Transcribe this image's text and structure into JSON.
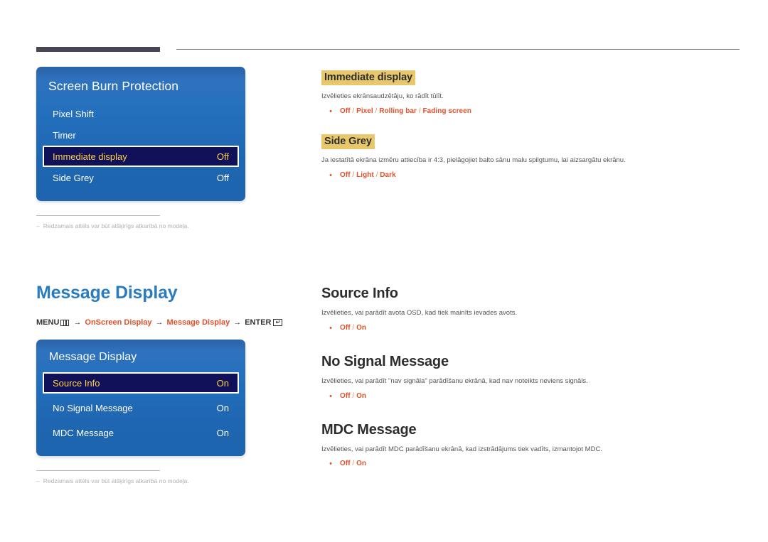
{
  "colors": {
    "accent_orange": "#e0502a",
    "heading_blue": "#2a7cc0",
    "highlight_yellow": "#e8c86a",
    "osd_blue": "#1f66b2",
    "osd_selected_bg": "#111159",
    "osd_selected_text": "#ffd24a"
  },
  "sections": [
    {
      "id": "screen-burn-protection",
      "panel": {
        "title": "Screen Burn Protection",
        "rows": [
          {
            "label": "Pixel Shift",
            "value": "",
            "selected": false
          },
          {
            "label": "Timer",
            "value": "",
            "selected": false
          },
          {
            "label": "Immediate display",
            "value": "Off",
            "selected": true
          },
          {
            "label": "Side Grey",
            "value": "Off",
            "selected": false
          }
        ]
      },
      "footnote": {
        "dash": "–",
        "text": "Redzamais attēls var būt atšķirīgs atkarībā no modeļa."
      },
      "topics": [
        {
          "heading": "Immediate display",
          "heading_style": "highlight",
          "description": "Izvēlieties ekrānsaudzētāju, ko rādīt tūlīt.",
          "bullet": "•",
          "options": [
            "Off",
            "Pixel",
            "Rolling bar",
            "Fading screen"
          ]
        },
        {
          "heading": "Side Grey",
          "heading_style": "highlight",
          "description": "Ja iestatītā ekrāna izmēru attiecība ir 4:3, pielāgojiet balto sānu malu spilgtumu, lai aizsargātu ekrānu.",
          "bullet": "•",
          "options": [
            "Off",
            "Light",
            "Dark"
          ]
        }
      ]
    },
    {
      "id": "message-display",
      "section_title": "Message Display",
      "breadcrumb": {
        "menu_label": "MENU",
        "menu_icon": "menu-icon",
        "arrow": "→",
        "items": [
          "OnScreen Display",
          "Message Display"
        ],
        "enter_label": "ENTER",
        "enter_icon": "enter-key-icon",
        "enter_glyph": "↵"
      },
      "panel": {
        "title": "Message Display",
        "rows": [
          {
            "label": "Source Info",
            "value": "On",
            "selected": true
          },
          {
            "label": "No Signal Message",
            "value": "On",
            "selected": false
          },
          {
            "label": "MDC Message",
            "value": "On",
            "selected": false
          }
        ]
      },
      "footnote": {
        "dash": "–",
        "text": "Redzamais attēls var būt atšķirīgs atkarībā no modeļa."
      },
      "topics": [
        {
          "heading": "Source Info",
          "heading_style": "plain",
          "description": "Izvēlieties, vai parādīt avota OSD, kad tiek mainīts ievades avots.",
          "bullet": "•",
          "options": [
            "Off",
            "On"
          ]
        },
        {
          "heading": "No Signal Message",
          "heading_style": "plain",
          "description": "Izvēlieties, vai parādīt \"nav signāla\" parādīšanu ekrānā, kad nav noteikts neviens signāls.",
          "bullet": "•",
          "options": [
            "Off",
            "On"
          ]
        },
        {
          "heading": "MDC Message",
          "heading_style": "plain",
          "description": "Izvēlieties, vai parādīt MDC parādīšanu ekrānā, kad izstrādājums tiek vadīts, izmantojot MDC.",
          "bullet": "•",
          "options": [
            "Off",
            "On"
          ]
        }
      ]
    }
  ]
}
